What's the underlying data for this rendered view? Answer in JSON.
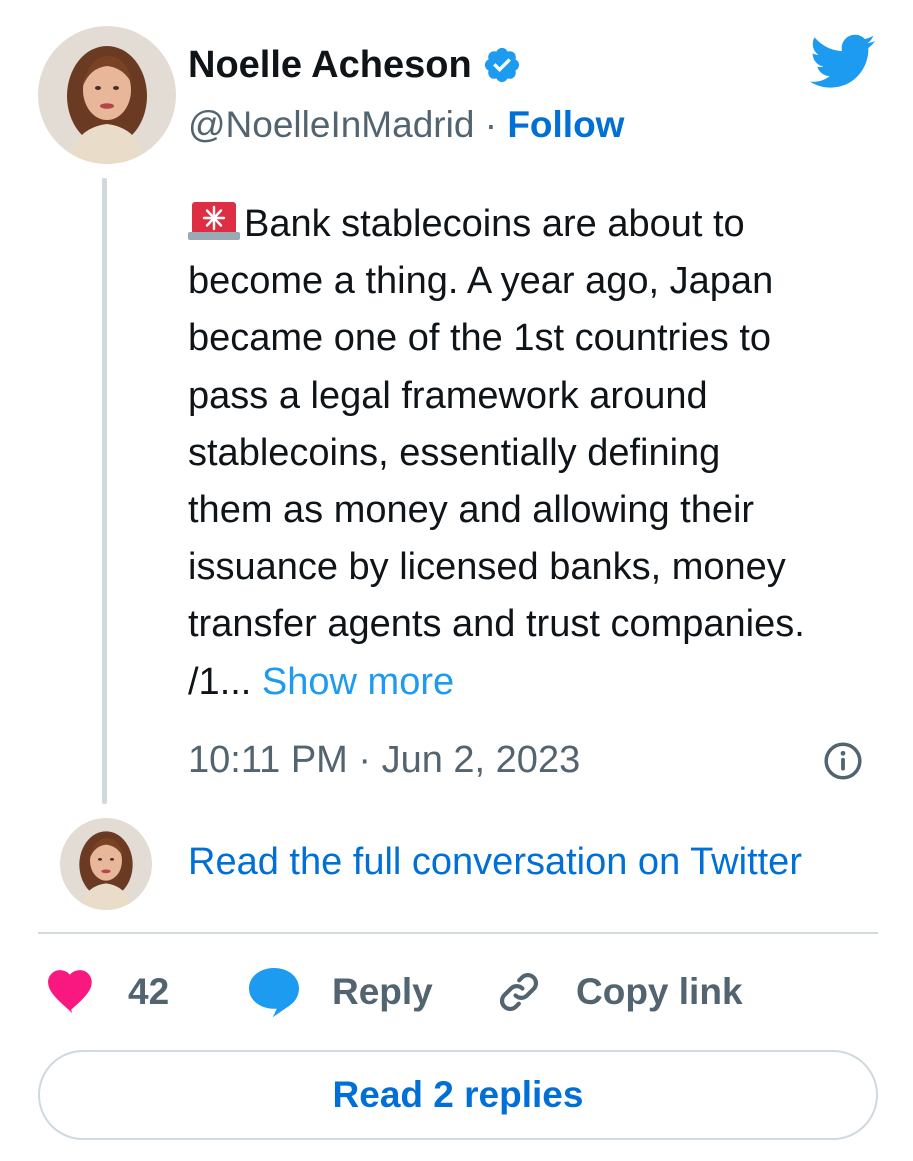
{
  "author": {
    "name": "Noelle Acheson",
    "handle": "@NoelleInMadrid",
    "separator": " · ",
    "follow_label": "Follow",
    "verified": true
  },
  "tweet": {
    "emoji": "rotating-light",
    "text": "Bank stablecoins are about to\nbecome a thing. A year ago, Japan\nbecame one of the 1st countries to\npass a legal framework around\nstablecoins, essentially defining\nthem as money and allowing their\nissuance by licensed banks, money\ntransfer agents and trust companies.\n/1... ",
    "show_more_label": "Show more",
    "timestamp": "10:11 PM · Jun 2, 2023"
  },
  "conversation": {
    "read_full_label": "Read the full conversation on Twitter"
  },
  "actions": {
    "like_count": "42",
    "reply_label": "Reply",
    "copy_link_label": "Copy link"
  },
  "footer": {
    "read_replies_label": "Read 2 replies"
  },
  "colors": {
    "link_blue": "#006fd6",
    "show_more_blue": "#1d9bf0",
    "muted_gray": "#536471",
    "heart_pink": "#f91880",
    "reply_blue": "#1d9bf0",
    "twitter_blue": "#1d9bf0",
    "divider": "#cfd9de"
  },
  "icons": {
    "verified": "verified-badge-icon",
    "twitter": "twitter-bird-icon",
    "info": "info-icon",
    "like": "heart-icon",
    "reply": "speech-bubble-icon",
    "copy": "link-icon",
    "alarm": "rotating-light-emoji"
  }
}
